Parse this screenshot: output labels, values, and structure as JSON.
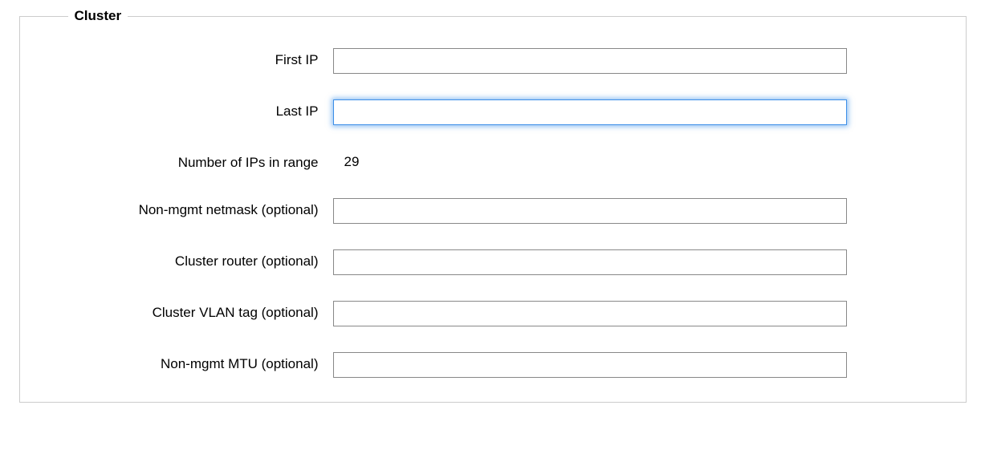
{
  "cluster": {
    "legend": "Cluster",
    "fields": {
      "first_ip": {
        "label": "First IP",
        "value": ""
      },
      "last_ip": {
        "label": "Last IP",
        "value": ""
      },
      "num_ips": {
        "label": "Number of IPs in range",
        "value": "29"
      },
      "nonmgmt_netmask": {
        "label": "Non-mgmt netmask (optional)",
        "value": ""
      },
      "cluster_router": {
        "label": "Cluster router (optional)",
        "value": ""
      },
      "cluster_vlan": {
        "label": "Cluster VLAN tag (optional)",
        "value": ""
      },
      "nonmgmt_mtu": {
        "label": "Non-mgmt MTU (optional)",
        "value": ""
      }
    }
  }
}
